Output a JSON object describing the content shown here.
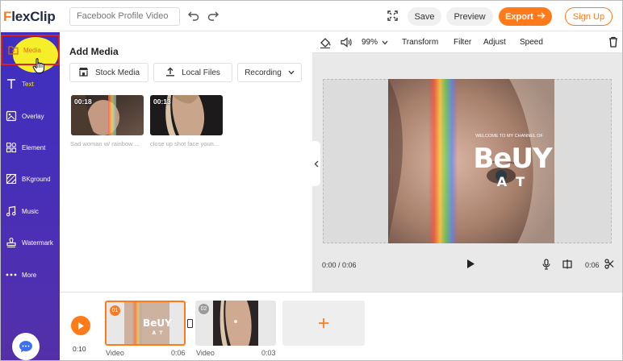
{
  "header": {
    "logo": {
      "first": "F",
      "rest": "lexClip"
    },
    "project_name": "Facebook Profile Video",
    "save_label": "Save",
    "preview_label": "Preview",
    "export_label": "Export",
    "signup_label": "Sign Up"
  },
  "sidebar": {
    "items": [
      {
        "label": "Media",
        "icon": "media-icon"
      },
      {
        "label": "Text",
        "icon": "text-icon"
      },
      {
        "label": "Overlay",
        "icon": "overlay-icon"
      },
      {
        "label": "Element",
        "icon": "element-icon"
      },
      {
        "label": "BKground",
        "icon": "background-icon"
      },
      {
        "label": "Music",
        "icon": "music-icon"
      },
      {
        "label": "Watermark",
        "icon": "watermark-icon"
      },
      {
        "label": "More",
        "icon": "more-icon"
      }
    ],
    "active": "Media"
  },
  "media_panel": {
    "title": "Add Media",
    "stock_label": "Stock Media",
    "local_label": "Local Files",
    "recording_label": "Recording",
    "thumbnails": [
      {
        "duration": "00:18",
        "caption": "Sad woman w/ rainbow ..."
      },
      {
        "duration": "00:13",
        "caption": "close up shot face youn..."
      }
    ]
  },
  "editor": {
    "volume": "99%",
    "transform_label": "Transform",
    "filter_label": "Filter",
    "adjust_label": "Adjust",
    "speed_label": "Speed",
    "overlay_small": "WELCOME TO MY CHANNEL OF",
    "overlay_big_top": "BeUY",
    "overlay_big_bottom": "A  T",
    "current_time": "0:00 / 0:06",
    "clip_time": "0:06"
  },
  "timeline": {
    "total_time": "0:10",
    "clips": [
      {
        "number": "01",
        "label": "Video",
        "duration": "0:06"
      },
      {
        "number": "02",
        "label": "Video",
        "duration": "0:03"
      }
    ]
  },
  "colors": {
    "accent": "#ff7a1a",
    "sidebar_top": "#3e2fc0",
    "sidebar_bottom": "#5430a8",
    "highlight": "#f5ef2a"
  }
}
